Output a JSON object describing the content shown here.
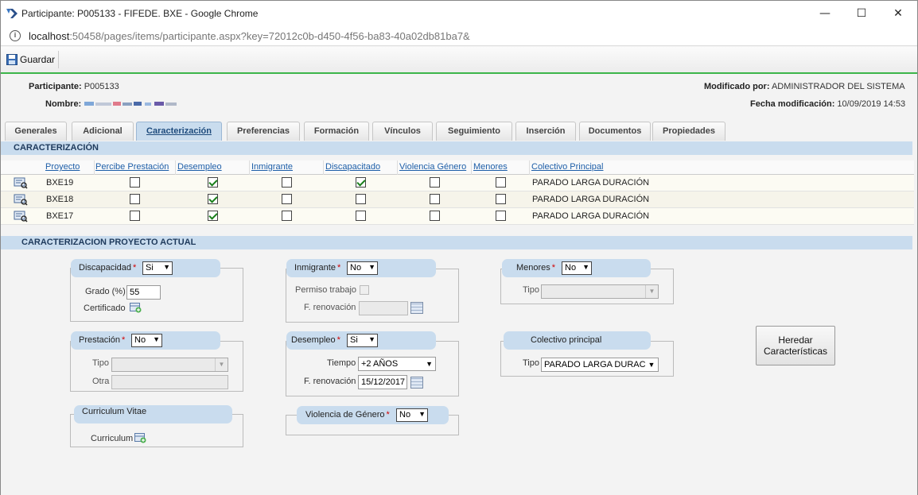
{
  "window": {
    "title": "Participante: P005133 - FIFEDE. BXE - Google Chrome",
    "url_host": "localhost",
    "url_rest": ":50458/pages/items/participante.aspx?key=72012c0b-d450-4f56-ba83-40a02db81ba7&",
    "minimize": "—",
    "maximize": "☐",
    "close": "✕"
  },
  "toolbar": {
    "save_label": "Guardar"
  },
  "header": {
    "participante_label": "Participante:",
    "participante_value": "P005133",
    "nombre_label": "Nombre:",
    "modificado_label": "Modificado por:",
    "modificado_value": "ADMINISTRADOR DEL SISTEMA",
    "fecha_label": "Fecha modificación:",
    "fecha_value": "10/09/2019 14:53"
  },
  "tabs": [
    {
      "label": "Generales"
    },
    {
      "label": "Adicional"
    },
    {
      "label": "Caracterización"
    },
    {
      "label": "Preferencias"
    },
    {
      "label": "Formación"
    },
    {
      "label": "Vínculos"
    },
    {
      "label": "Seguimiento"
    },
    {
      "label": "Inserción"
    },
    {
      "label": "Documentos"
    },
    {
      "label": "Propiedades"
    }
  ],
  "section1": {
    "title": "CARACTERIZACIÓN"
  },
  "grid": {
    "columns": [
      "Proyecto",
      "Percibe Prestación",
      "Desempleo",
      "Inmigrante",
      "Discapacitado",
      "Violencia Género",
      "Menores",
      "Colectivo Principal"
    ],
    "rows": [
      {
        "proyecto": "BXE19",
        "prestacion": false,
        "desempleo": true,
        "inmigrante": false,
        "discapacitado": true,
        "violencia": false,
        "menores": false,
        "colectivo": "PARADO LARGA DURACIÓN"
      },
      {
        "proyecto": "BXE18",
        "prestacion": false,
        "desempleo": true,
        "inmigrante": false,
        "discapacitado": false,
        "violencia": false,
        "menores": false,
        "colectivo": "PARADO LARGA DURACIÓN"
      },
      {
        "proyecto": "BXE17",
        "prestacion": false,
        "desempleo": true,
        "inmigrante": false,
        "discapacitado": false,
        "violencia": false,
        "menores": false,
        "colectivo": "PARADO LARGA DURACIÓN"
      }
    ]
  },
  "section2": {
    "title": "CARACTERIZACION PROYECTO ACTUAL"
  },
  "discapacidad": {
    "label": "Discapacidad",
    "value": "Si",
    "grado_label": "Grado (%)",
    "grado_value": "55",
    "certificado_label": "Certificado"
  },
  "prestacion": {
    "label": "Prestación",
    "value": "No",
    "tipo_label": "Tipo",
    "otra_label": "Otra"
  },
  "curriculum": {
    "label": "Curriculum Vitae",
    "field_label": "Curriculum"
  },
  "inmigrante": {
    "label": "Inmigrante",
    "value": "No",
    "permiso_label": "Permiso trabajo",
    "renovacion_label": "F. renovación"
  },
  "desempleo": {
    "label": "Desempleo",
    "value": "Si",
    "tiempo_label": "Tiempo",
    "tiempo_value": "+2 AÑOS",
    "renovacion_label": "F. renovación",
    "renovacion_value": "15/12/2017"
  },
  "violencia": {
    "label": "Violencia de Género",
    "value": "No"
  },
  "menores": {
    "label": "Menores",
    "value": "No",
    "tipo_label": "Tipo"
  },
  "colectivo": {
    "label": "Colectivo principal",
    "tipo_label": "Tipo",
    "tipo_value": "PARADO LARGA DURAC"
  },
  "heredar": {
    "label": "Heredar Características"
  },
  "required_mark": "*"
}
